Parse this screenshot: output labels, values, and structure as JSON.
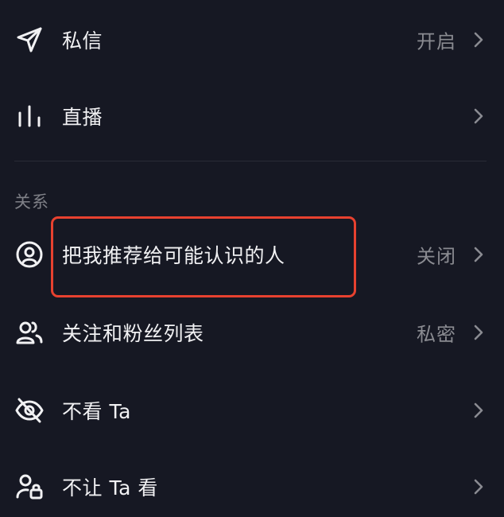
{
  "settings": {
    "messages": {
      "label": "私信",
      "value": "开启",
      "icon": "paper-plane-icon"
    },
    "live": {
      "label": "直播",
      "value": "",
      "icon": "bar-chart-icon"
    },
    "section_relationship": "关系",
    "recommend": {
      "label": "把我推荐给可能认识的人",
      "value": "关闭",
      "icon": "user-circle-icon"
    },
    "follow_list": {
      "label": "关注和粉丝列表",
      "value": "私密",
      "icon": "users-icon"
    },
    "hide_them": {
      "label": "不看 Ta",
      "value": "",
      "icon": "eye-off-icon"
    },
    "block_them": {
      "label": "不让 Ta 看",
      "value": "",
      "icon": "user-lock-icon"
    }
  },
  "colors": {
    "background": "#161823",
    "text": "#f1f1f3",
    "secondary_text": "#8a8b91",
    "highlight_border": "#e7412f"
  }
}
